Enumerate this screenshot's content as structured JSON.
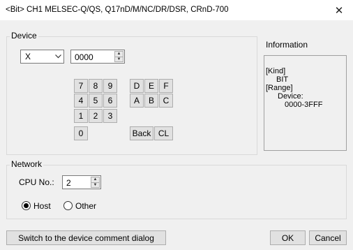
{
  "window": {
    "title": "<Bit> CH1 MELSEC-Q/QS, Q17nD/M/NC/DR/DSR, CRnD-700",
    "close_glyph": "✕"
  },
  "device_group": {
    "label": "Device",
    "device_type": "X",
    "device_number": "0000",
    "keypad": {
      "digits": [
        "7",
        "8",
        "9",
        "4",
        "5",
        "6",
        "1",
        "2",
        "3",
        "0"
      ],
      "hex": [
        "D",
        "E",
        "F",
        "A",
        "B",
        "C"
      ],
      "back_label": "Back",
      "clear_label": "CL"
    }
  },
  "information": {
    "label": "Information",
    "lines": [
      "[Kind]",
      "BIT",
      "[Range]",
      "Device:",
      "0000-3FFF"
    ]
  },
  "network_group": {
    "label": "Network",
    "cpu_label": "CPU No.:",
    "cpu_value": "2",
    "host_label": "Host",
    "other_label": "Other",
    "selected": "Host"
  },
  "footer": {
    "switch_label": "Switch to the device comment dialog",
    "ok_label": "OK",
    "cancel_label": "Cancel"
  },
  "icons": {
    "dropdown": "chevron-down-icon",
    "spin_up": "spin-up-icon",
    "spin_down": "spin-down-icon"
  }
}
